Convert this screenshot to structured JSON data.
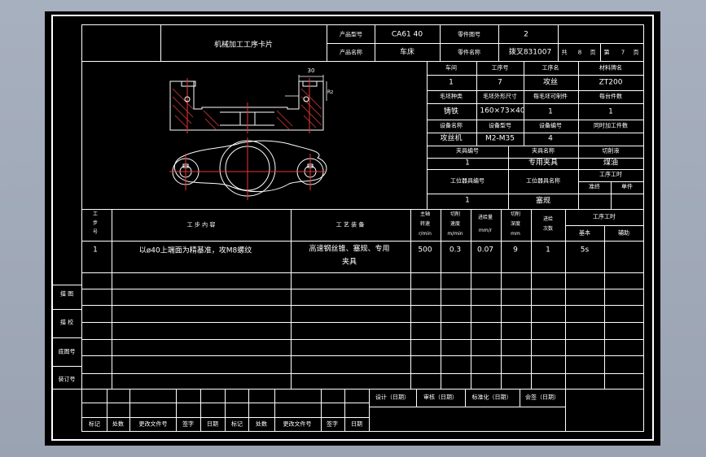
{
  "header": {
    "card_title": "机械加工工序卡片",
    "product_model_label": "产品型号",
    "product_model": "CA61 40",
    "part_number_label": "零件图号",
    "part_number": "2",
    "product_name_label": "产品名称",
    "product_name": "车床",
    "part_name_label": "零件名称",
    "part_name": "拨叉831007",
    "total_label": "共",
    "total_pages": "8",
    "page_unit": "页",
    "page_label": "第",
    "page_no": "7",
    "page_unit2": "页"
  },
  "info": {
    "workshop_label": "车间",
    "op_no_label": "工序号",
    "op_name_label": "工序名",
    "material_label": "材料牌名",
    "workshop": "1",
    "op_no": "7",
    "op_name": "攻丝",
    "material": "ZT200",
    "blank_type_label": "毛坯种类",
    "blank_size_label": "毛坯外形尺寸",
    "per_blank_label": "每毛坯可制件",
    "per_unit_label": "每台件数",
    "blank_type": "铸铁",
    "blank_size": "160×73×40",
    "per_blank": "1",
    "per_unit": "1",
    "equip_name_label": "设备名称",
    "equip_model_label": "设备型号",
    "equip_no_label": "设备编号",
    "simul_label": "同时加工件数",
    "equip_name": "攻丝机",
    "equip_model": "M2-M35",
    "equip_no": "4",
    "fixture_no_label": "夹具编号",
    "fixture_name_label": "夹具名称",
    "coolant_label": "切削液",
    "fixture_no": "1",
    "fixture_name": "专用夹具",
    "coolant": "煤油",
    "station_tool_no_label": "工位器具编号",
    "station_tool_name_label": "工位器具名称",
    "op_time_label": "工序工时",
    "prep_label": "准终",
    "unit_label": "单件",
    "station_tool_no": "1",
    "station_tool_name": "塞规"
  },
  "drawing": {
    "dim_top": "30",
    "dim_side": "Rz"
  },
  "steps": {
    "headers": {
      "step_no": "工步号",
      "step_content": "工 步 内 容",
      "equipment": "工 艺 装 备",
      "spindle_speed": "主轴转速r/min",
      "cut_speed": "切削速度m/min",
      "feed": "进给量mm/r",
      "cut_depth": "切削深度mm",
      "passes": "进给次数",
      "step_time": "工序工时",
      "basic": "基本",
      "aux": "辅助"
    },
    "rows": [
      {
        "no": "1",
        "content": "以ø40上端面为精基准，攻M8螺纹",
        "equipment_line1": "高速钢丝锥、塞规、专用",
        "equipment_line2": "夹具",
        "spindle": "500",
        "speed": "0.3",
        "feed": "0.07",
        "depth": "9",
        "passes": "1",
        "basic": "5s"
      }
    ]
  },
  "side": {
    "drawn": "描 图",
    "checked": "描 校",
    "base_no": "底图号",
    "bind_no": "装订号"
  },
  "footer": {
    "design": "设计（日期）",
    "review": "审核（日期）",
    "standard": "标准化（日期）",
    "sign": "会签（日期）",
    "mark": "标记",
    "count": "处数",
    "doc_no": "更改文件号",
    "signature": "签字",
    "date": "日期"
  }
}
